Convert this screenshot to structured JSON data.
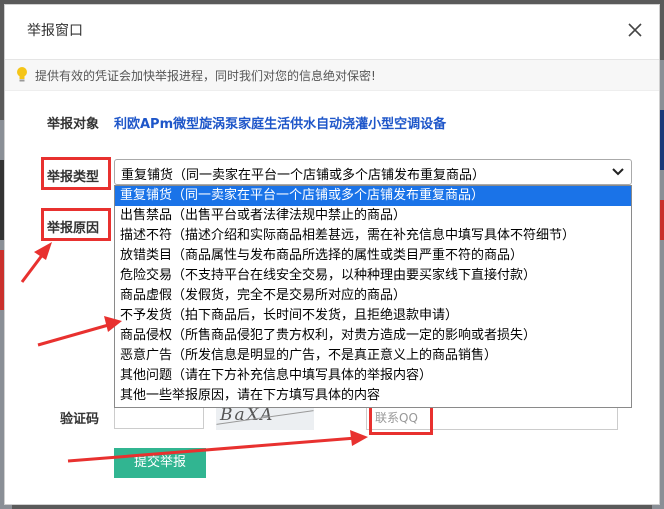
{
  "dialog": {
    "title": "举报窗口",
    "notice": "提供有效的凭证会加快举报进程，同时我们对您的信息绝对保密!"
  },
  "form": {
    "target_label": "举报对象",
    "target_value": "利欧APm微型旋涡泵家庭生活供水自动浇灌小型空调设备",
    "type_label": "举报类型",
    "type_selected": "重复铺货（同一卖家在平台一个店铺或多个店铺发布重复商品）",
    "reason_label": "举报原因",
    "options": [
      "重复铺货（同一卖家在平台一个店铺或多个店铺发布重复商品）",
      "出售禁品（出售平台或者法律法规中禁止的商品）",
      "描述不符（描述介绍和实际商品相差甚远，需在补充信息中填写具体不符细节）",
      "放错类目（商品属性与发布商品所选择的属性或类目严重不符的商品）",
      "危险交易（不支持平台在线安全交易，以种种理由要买家线下直接付款）",
      "商品虚假（发假货，完全不是交易所对应的商品）",
      "不予发货（拍下商品后，长时间不发货，且拒绝退款申请）",
      "商品侵权（所售商品侵犯了贵方权利，对贵方造成一定的影响或者损失）",
      "恶意广告（所发信息是明显的广告，不是真正意义上的商品销售）",
      "其他问题（请在下方补充信息中填写具体的举报内容）",
      "其他一些举报原因，请在下方填写具体的内容"
    ],
    "captcha_label": "验证码",
    "captcha_text": "BaXA",
    "contact_placeholder": "联系QQ",
    "submit_label": "提交举报"
  },
  "colors": {
    "highlight": "#e8312f",
    "link": "#1e56c9",
    "selected_option": "#1a73e8",
    "submit": "#31b591"
  }
}
